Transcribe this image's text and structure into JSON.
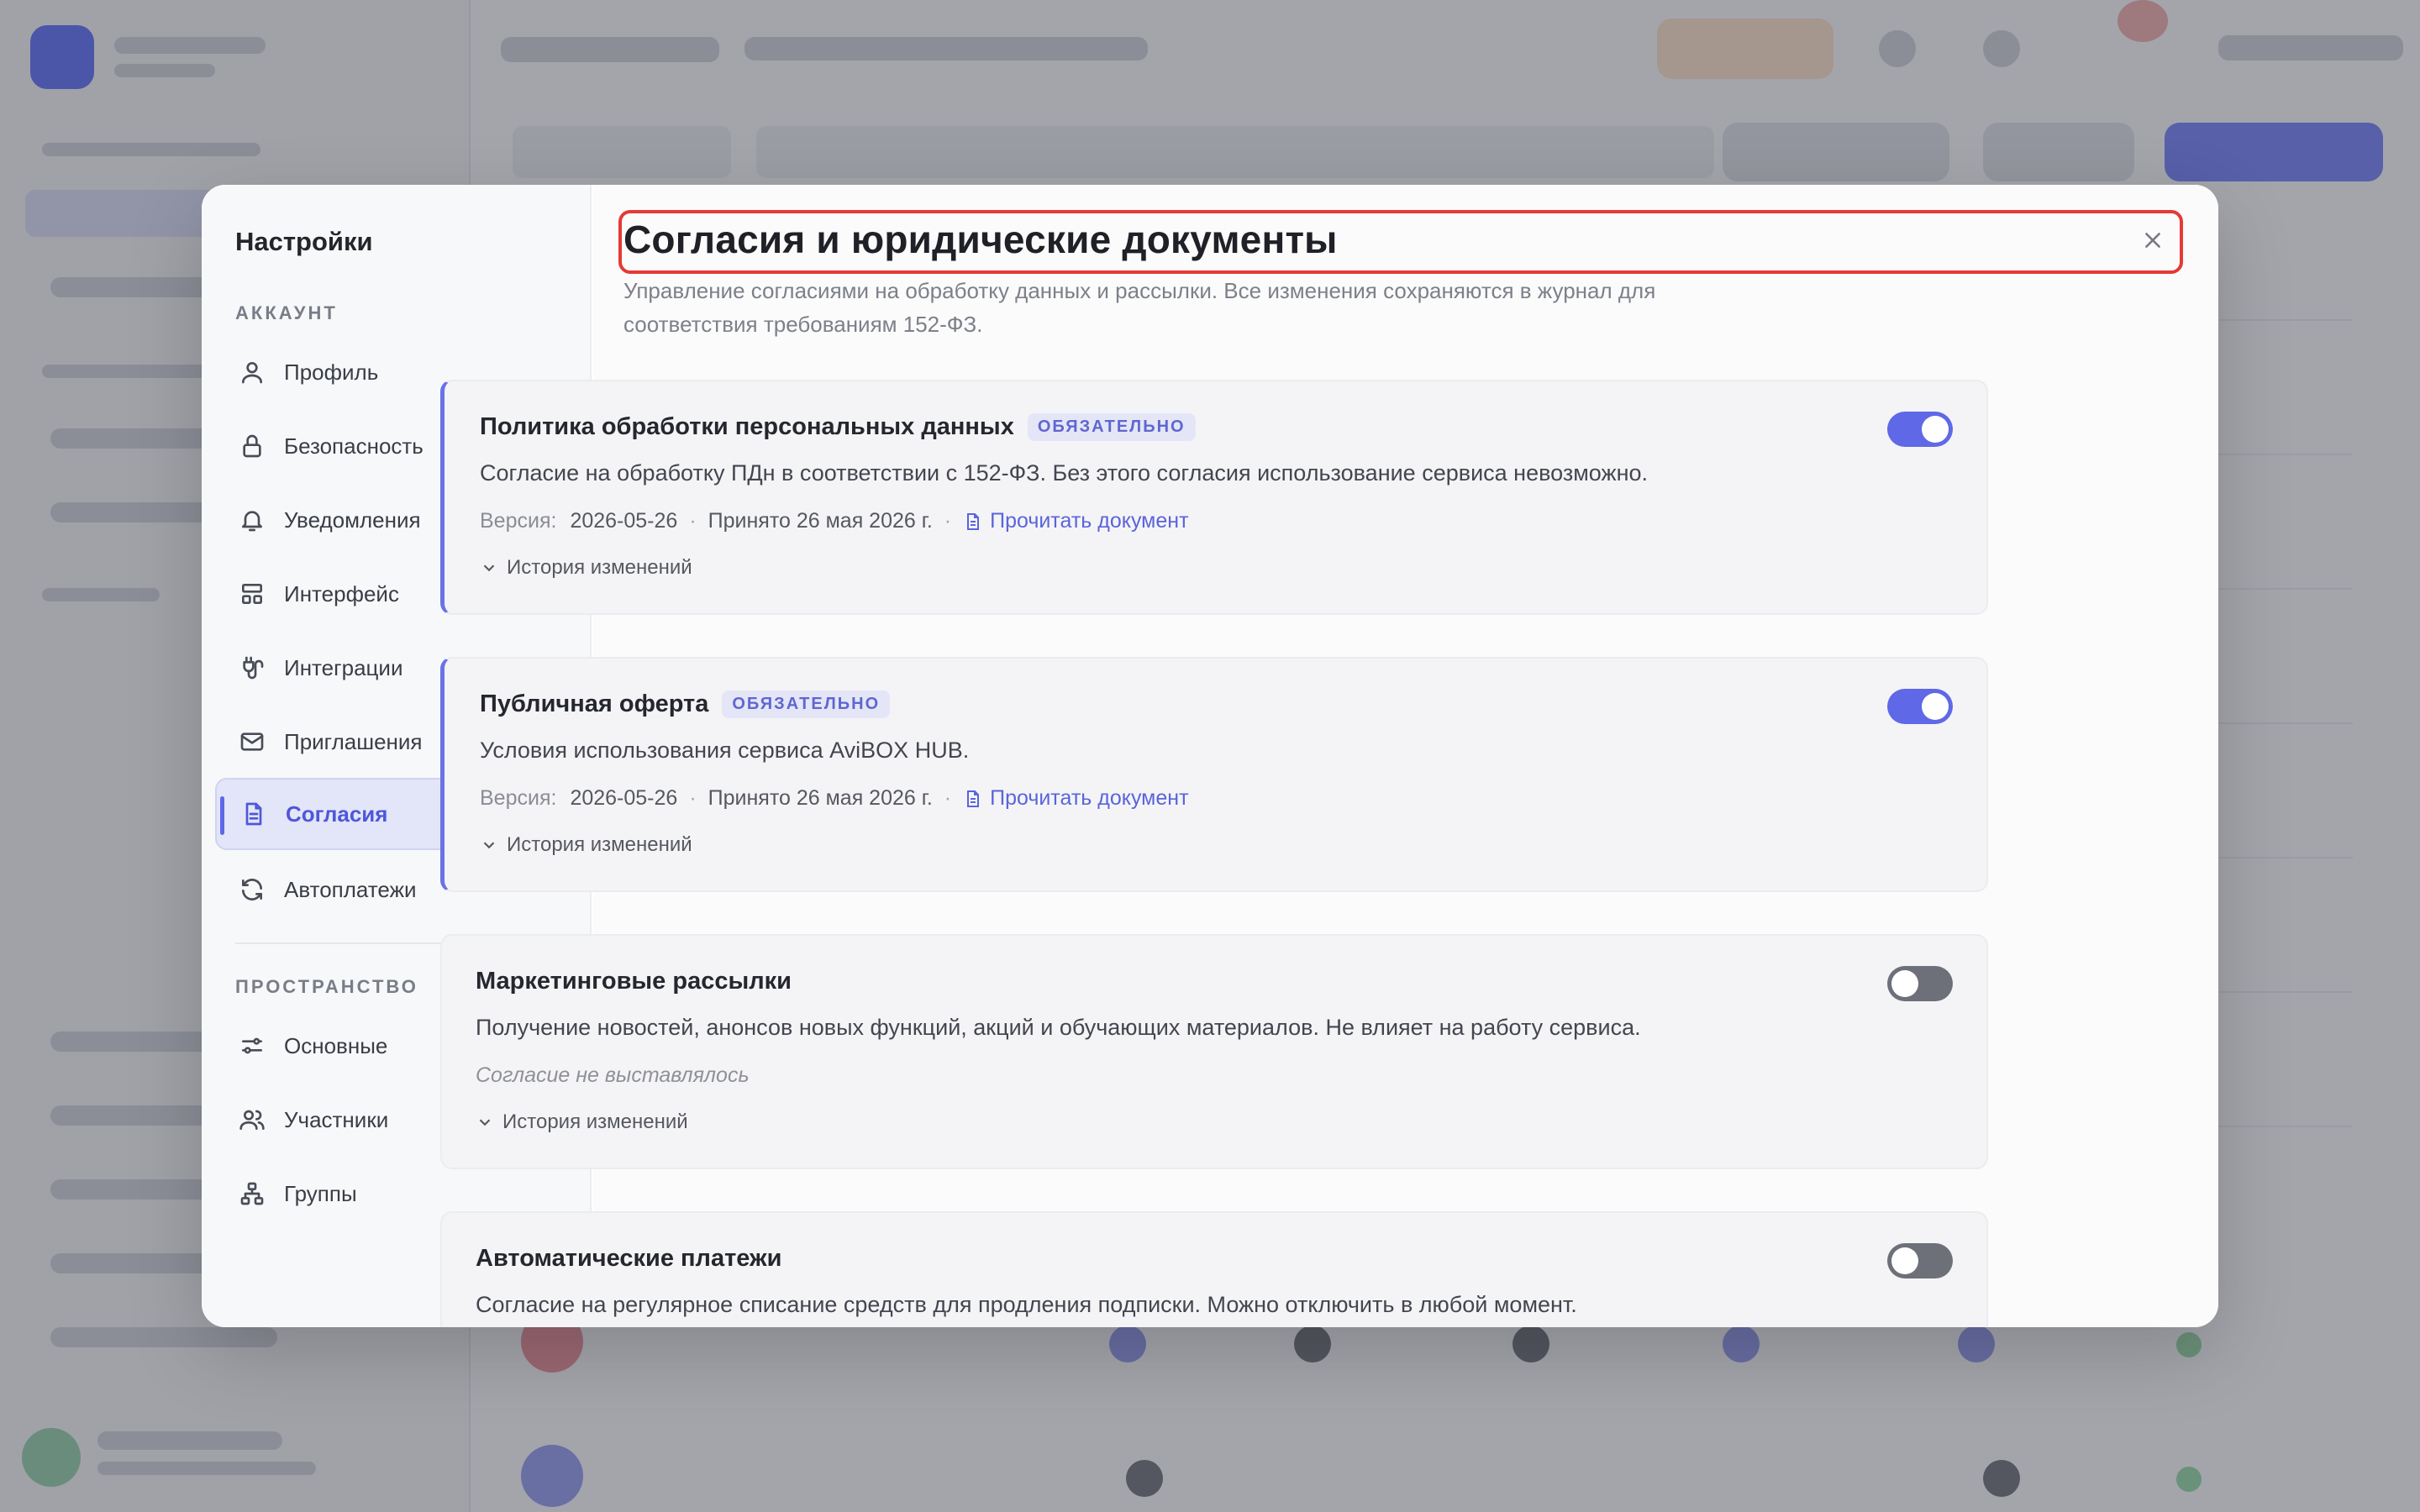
{
  "sidebar": {
    "title": "Настройки",
    "section_account": "АККАУНТ",
    "section_space": "ПРОСТРАНСТВО",
    "account_items": [
      {
        "label": "Профиль",
        "icon": "user-icon"
      },
      {
        "label": "Безопасность",
        "icon": "lock-icon"
      },
      {
        "label": "Уведомления",
        "icon": "bell-icon"
      },
      {
        "label": "Интерфейс",
        "icon": "layout-icon"
      },
      {
        "label": "Интеграции",
        "icon": "plug-icon"
      },
      {
        "label": "Приглашения",
        "icon": "mail-icon"
      },
      {
        "label": "Согласия",
        "icon": "document-icon",
        "active": true
      },
      {
        "label": "Автоплатежи",
        "icon": "refresh-icon"
      }
    ],
    "space_items": [
      {
        "label": "Основные",
        "icon": "sliders-icon"
      },
      {
        "label": "Участники",
        "icon": "users-icon"
      },
      {
        "label": "Группы",
        "icon": "hierarchy-icon"
      }
    ]
  },
  "main": {
    "title": "Согласия и юридические документы",
    "subtitle": "Управление согласиями на обработку данных и рассылки. Все изменения сохраняются в журнал для соответствия требованиям 152-ФЗ.",
    "cards": [
      {
        "title": "Политика обработки персональных данных",
        "badge": "ОБЯЗАТЕЛЬНО",
        "description": "Согласие на обработку ПДн в соответствии с 152-ФЗ. Без этого согласия использование сервиса невозможно.",
        "version_label": "Версия:",
        "version": "2026-05-26",
        "accepted": "Принято 26 мая 2026 г.",
        "link": "Прочитать документ",
        "history": "История изменений",
        "enabled": true
      },
      {
        "title": "Публичная оферта",
        "badge": "ОБЯЗАТЕЛЬНО",
        "description": "Условия использования сервиса AviBOX HUB.",
        "version_label": "Версия:",
        "version": "2026-05-26",
        "accepted": "Принято 26 мая 2026 г.",
        "link": "Прочитать документ",
        "history": "История изменений",
        "enabled": true
      },
      {
        "title": "Маркетинговые рассылки",
        "description": "Получение новостей, анонсов новых функций, акций и обучающих материалов. Не влияет на работу сервиса.",
        "status": "Согласие не выставлялось",
        "history": "История изменений",
        "enabled": false
      },
      {
        "title": "Автоматические платежи",
        "description": "Согласие на регулярное списание средств для продления подписки. Можно отключить в любой момент.",
        "enabled": false
      }
    ]
  },
  "colors": {
    "accent": "#5f68e6",
    "highlight_border": "#e53935",
    "toggle_off": "#6d7079"
  }
}
